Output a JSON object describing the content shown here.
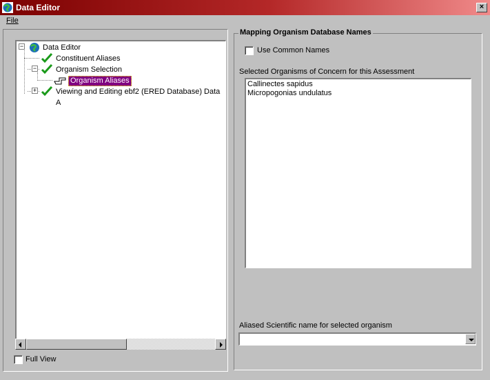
{
  "window": {
    "title": "Data Editor",
    "close_glyph": "×"
  },
  "menu": {
    "file_label": "File"
  },
  "tree": {
    "root": "Data Editor",
    "items": [
      {
        "label": "Constituent Aliases"
      },
      {
        "label": "Organism Selection"
      },
      {
        "label": "Organism Aliases"
      },
      {
        "label": "Viewing and Editing ebf2 (ERED Database) Data A"
      }
    ]
  },
  "full_view": {
    "label": "Full View",
    "checked": false
  },
  "mapping": {
    "group_title": "Mapping Organism Database Names",
    "use_common_label": "Use Common Names",
    "selected_label": "Selected Organisms of Concern for this Assessment",
    "organisms": [
      "Callinectes sapidus",
      "Micropogonias undulatus"
    ],
    "aliased_label": "Aliased Scientific name for selected organism",
    "aliased_value": ""
  },
  "colors": {
    "selection": "#800080",
    "check": "#1a9a1a",
    "title_start": "#7b0000",
    "title_end": "#f08a8a"
  }
}
